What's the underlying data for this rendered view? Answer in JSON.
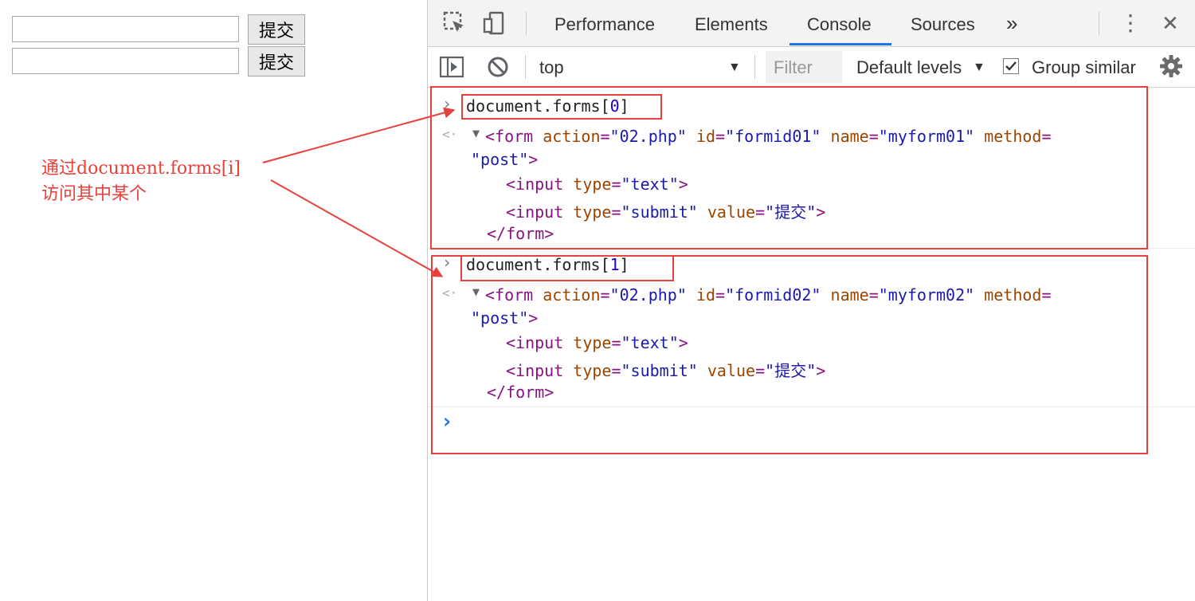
{
  "page": {
    "forms": [
      {
        "input_value": "",
        "submit_label": "提交"
      },
      {
        "input_value": "",
        "submit_label": "提交"
      }
    ],
    "annotation": {
      "line1": "通过document.forms[i]",
      "line2": "访问其中某个",
      "color": "#e8403b"
    }
  },
  "devtools": {
    "tabs": [
      {
        "label": "Performance"
      },
      {
        "label": "Elements"
      },
      {
        "label": "Console",
        "active": true
      },
      {
        "label": "Sources"
      }
    ],
    "more_tabs": "»",
    "menu_icon": "⋮",
    "close_icon": "✕",
    "toolbar": {
      "context": "top",
      "filter_placeholder": "Filter",
      "levels": "Default levels",
      "group_similar": "Group similar",
      "group_similar_checked": true
    },
    "accent": "#1a73e8",
    "console": {
      "entries": [
        {
          "input_prefix": "document.forms[",
          "input_index": "0",
          "input_suffix": "]",
          "form": {
            "action": "\"02.php\"",
            "id": "\"formid01\"",
            "name": "\"myform01\"",
            "method": "\"post\""
          },
          "children": [
            {
              "type": "\"text\""
            },
            {
              "type": "\"submit\"",
              "value": "\"提交\""
            }
          ]
        },
        {
          "input_prefix": "document.forms[",
          "input_index": "1",
          "input_suffix": "]",
          "form": {
            "action": "\"02.php\"",
            "id": "\"formid02\"",
            "name": "\"myform02\"",
            "method": "\"post\""
          },
          "children": [
            {
              "type": "\"text\""
            },
            {
              "type": "\"submit\"",
              "value": "\"提交\""
            }
          ]
        }
      ],
      "prompt": "›"
    }
  }
}
